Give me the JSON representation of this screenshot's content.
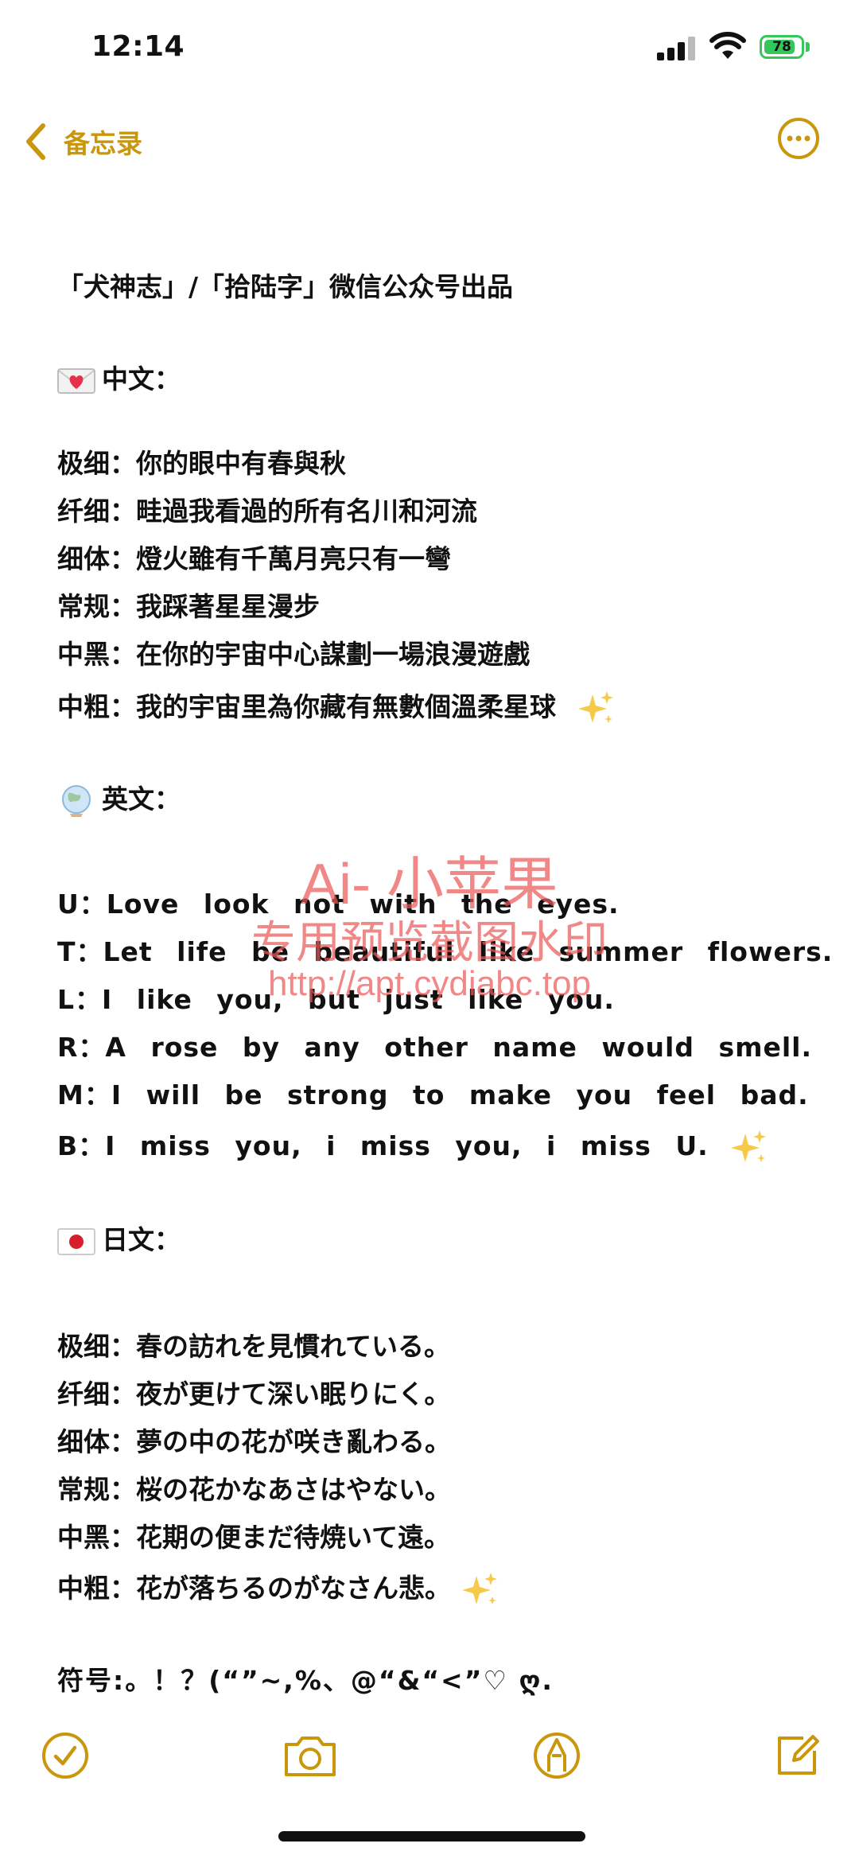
{
  "status_bar": {
    "time": "12:14",
    "battery_level": "78",
    "battery_color": "#34c759"
  },
  "nav": {
    "back_label": "备忘录",
    "accent_color": "#c9960c",
    "back_icon": "chevron-left-icon",
    "more_icon": "ellipsis-circle-icon"
  },
  "note": {
    "header": "「犬神志」/「拾陆字」微信公众号出品",
    "chinese_section": {
      "title": "中文：",
      "emoji": "love-letter-icon",
      "lines": [
        "极细：你的眼中有春與秋",
        "纤细：畦過我看過的所有名川和河流",
        "细体：燈火雖有千萬月亮只有一彎",
        "常规：我踩著星星漫步",
        "中黑：在你的宇宙中心謀劃一場浪漫遊戲",
        "中粗：我的宇宙里為你藏有無數個溫柔星球"
      ]
    },
    "english_section": {
      "title": "英文：",
      "emoji": "globe-icon",
      "lines": [
        "U：Love look not with the eyes.",
        "T：Let life be beautiful like summer flowers.",
        "L：I like you, but just like you.",
        "R：A rose by any other name would smell.",
        "M：I will be strong to make you feel bad.",
        "B：I miss you, i miss you, i miss U."
      ]
    },
    "japanese_section": {
      "title": "日文：",
      "emoji": "japan-flag-icon",
      "lines": [
        "极细：春の訪れを見慣れている。",
        "纤细：夜が更けて深い眠りにく。",
        "细体：夢の中の花が咲き亂わる。",
        "常规：桜の花かなあさはやない。",
        "中黑：花期の便まだ待焼いて遠。",
        "中粗：花が落ちるのがなさん悲。"
      ]
    },
    "symbols_line": "符号:。！？(“”~,%、@“&“<”♡ ღ."
  },
  "watermark": {
    "title": "Ai- 小苹果",
    "subtitle": "专用预览截图水印",
    "url": "http://apt.cydiabc.top"
  },
  "toolbar": {
    "items": [
      "checklist-icon",
      "camera-icon",
      "markup-pen-icon",
      "compose-icon"
    ]
  }
}
